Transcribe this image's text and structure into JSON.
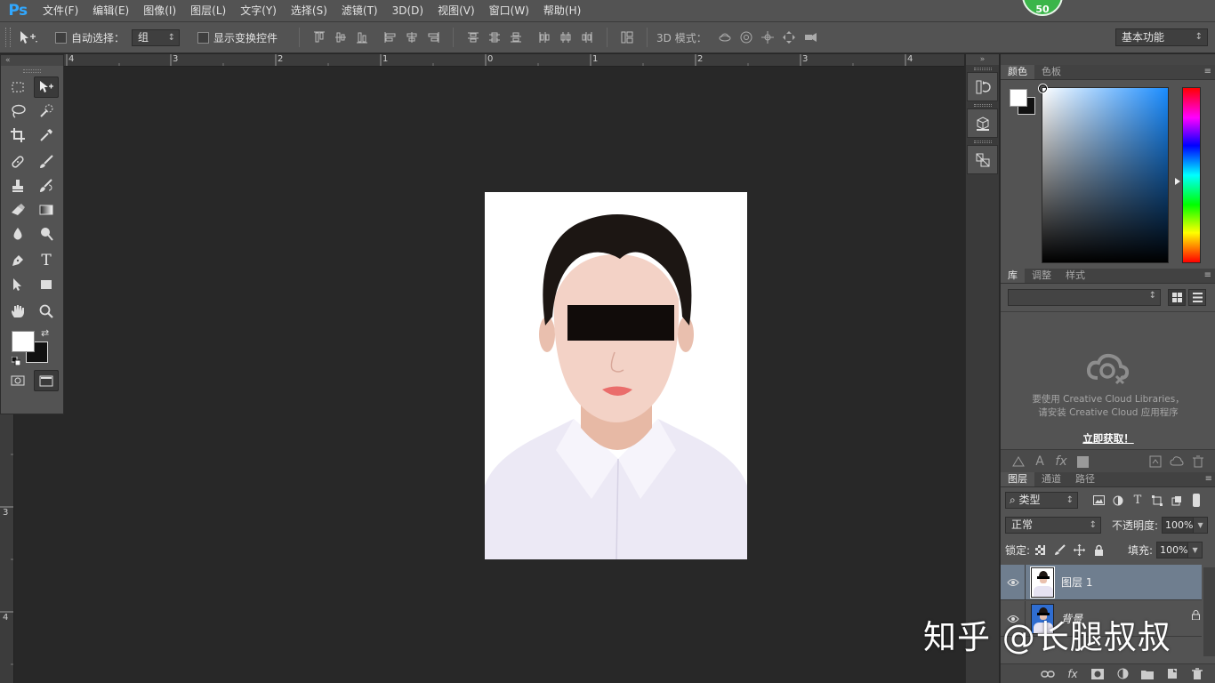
{
  "app": {
    "logo": "Ps",
    "notification_count": "50"
  },
  "menu": [
    "文件(F)",
    "编辑(E)",
    "图像(I)",
    "图层(L)",
    "文字(Y)",
    "选择(S)",
    "滤镜(T)",
    "3D(D)",
    "视图(V)",
    "窗口(W)",
    "帮助(H)"
  ],
  "options": {
    "auto_select_label": "自动选择：",
    "auto_select_value": "组",
    "show_transform_label": "显示变换控件",
    "mode_3d_label": "3D 模式：",
    "workspace": "基本功能"
  },
  "rulers": {
    "top": [
      "4",
      "3",
      "2",
      "1",
      "0",
      "1",
      "2",
      "3",
      "4"
    ],
    "left": [
      "3",
      "4"
    ]
  },
  "tools": {
    "text_tool_glyph": "T",
    "foreground_color": "#ffffff",
    "background_color": "#111111"
  },
  "color_panel": {
    "tabs": [
      "颜色",
      "色板"
    ]
  },
  "library_panel": {
    "tabs": [
      "库",
      "调整",
      "样式"
    ],
    "message_line1": "要使用 Creative Cloud Libraries，",
    "message_line2": "请安装 Creative Cloud 应用程序",
    "install_link": "立即获取！",
    "fx_glyph": "fx",
    "a_glyph": "A"
  },
  "layers_panel": {
    "tabs": [
      "图层",
      "通道",
      "路径"
    ],
    "filter_kind": "类型",
    "blend_mode": "正常",
    "opacity_label": "不透明度:",
    "opacity_value": "100%",
    "lock_label": "锁定:",
    "fill_label": "填充:",
    "fill_value": "100%",
    "layers": [
      {
        "name": "图层 1",
        "selected": true
      },
      {
        "name": "背景",
        "selected": false
      }
    ],
    "fx_glyph": "fx"
  },
  "watermark": "知乎 @长腿叔叔"
}
